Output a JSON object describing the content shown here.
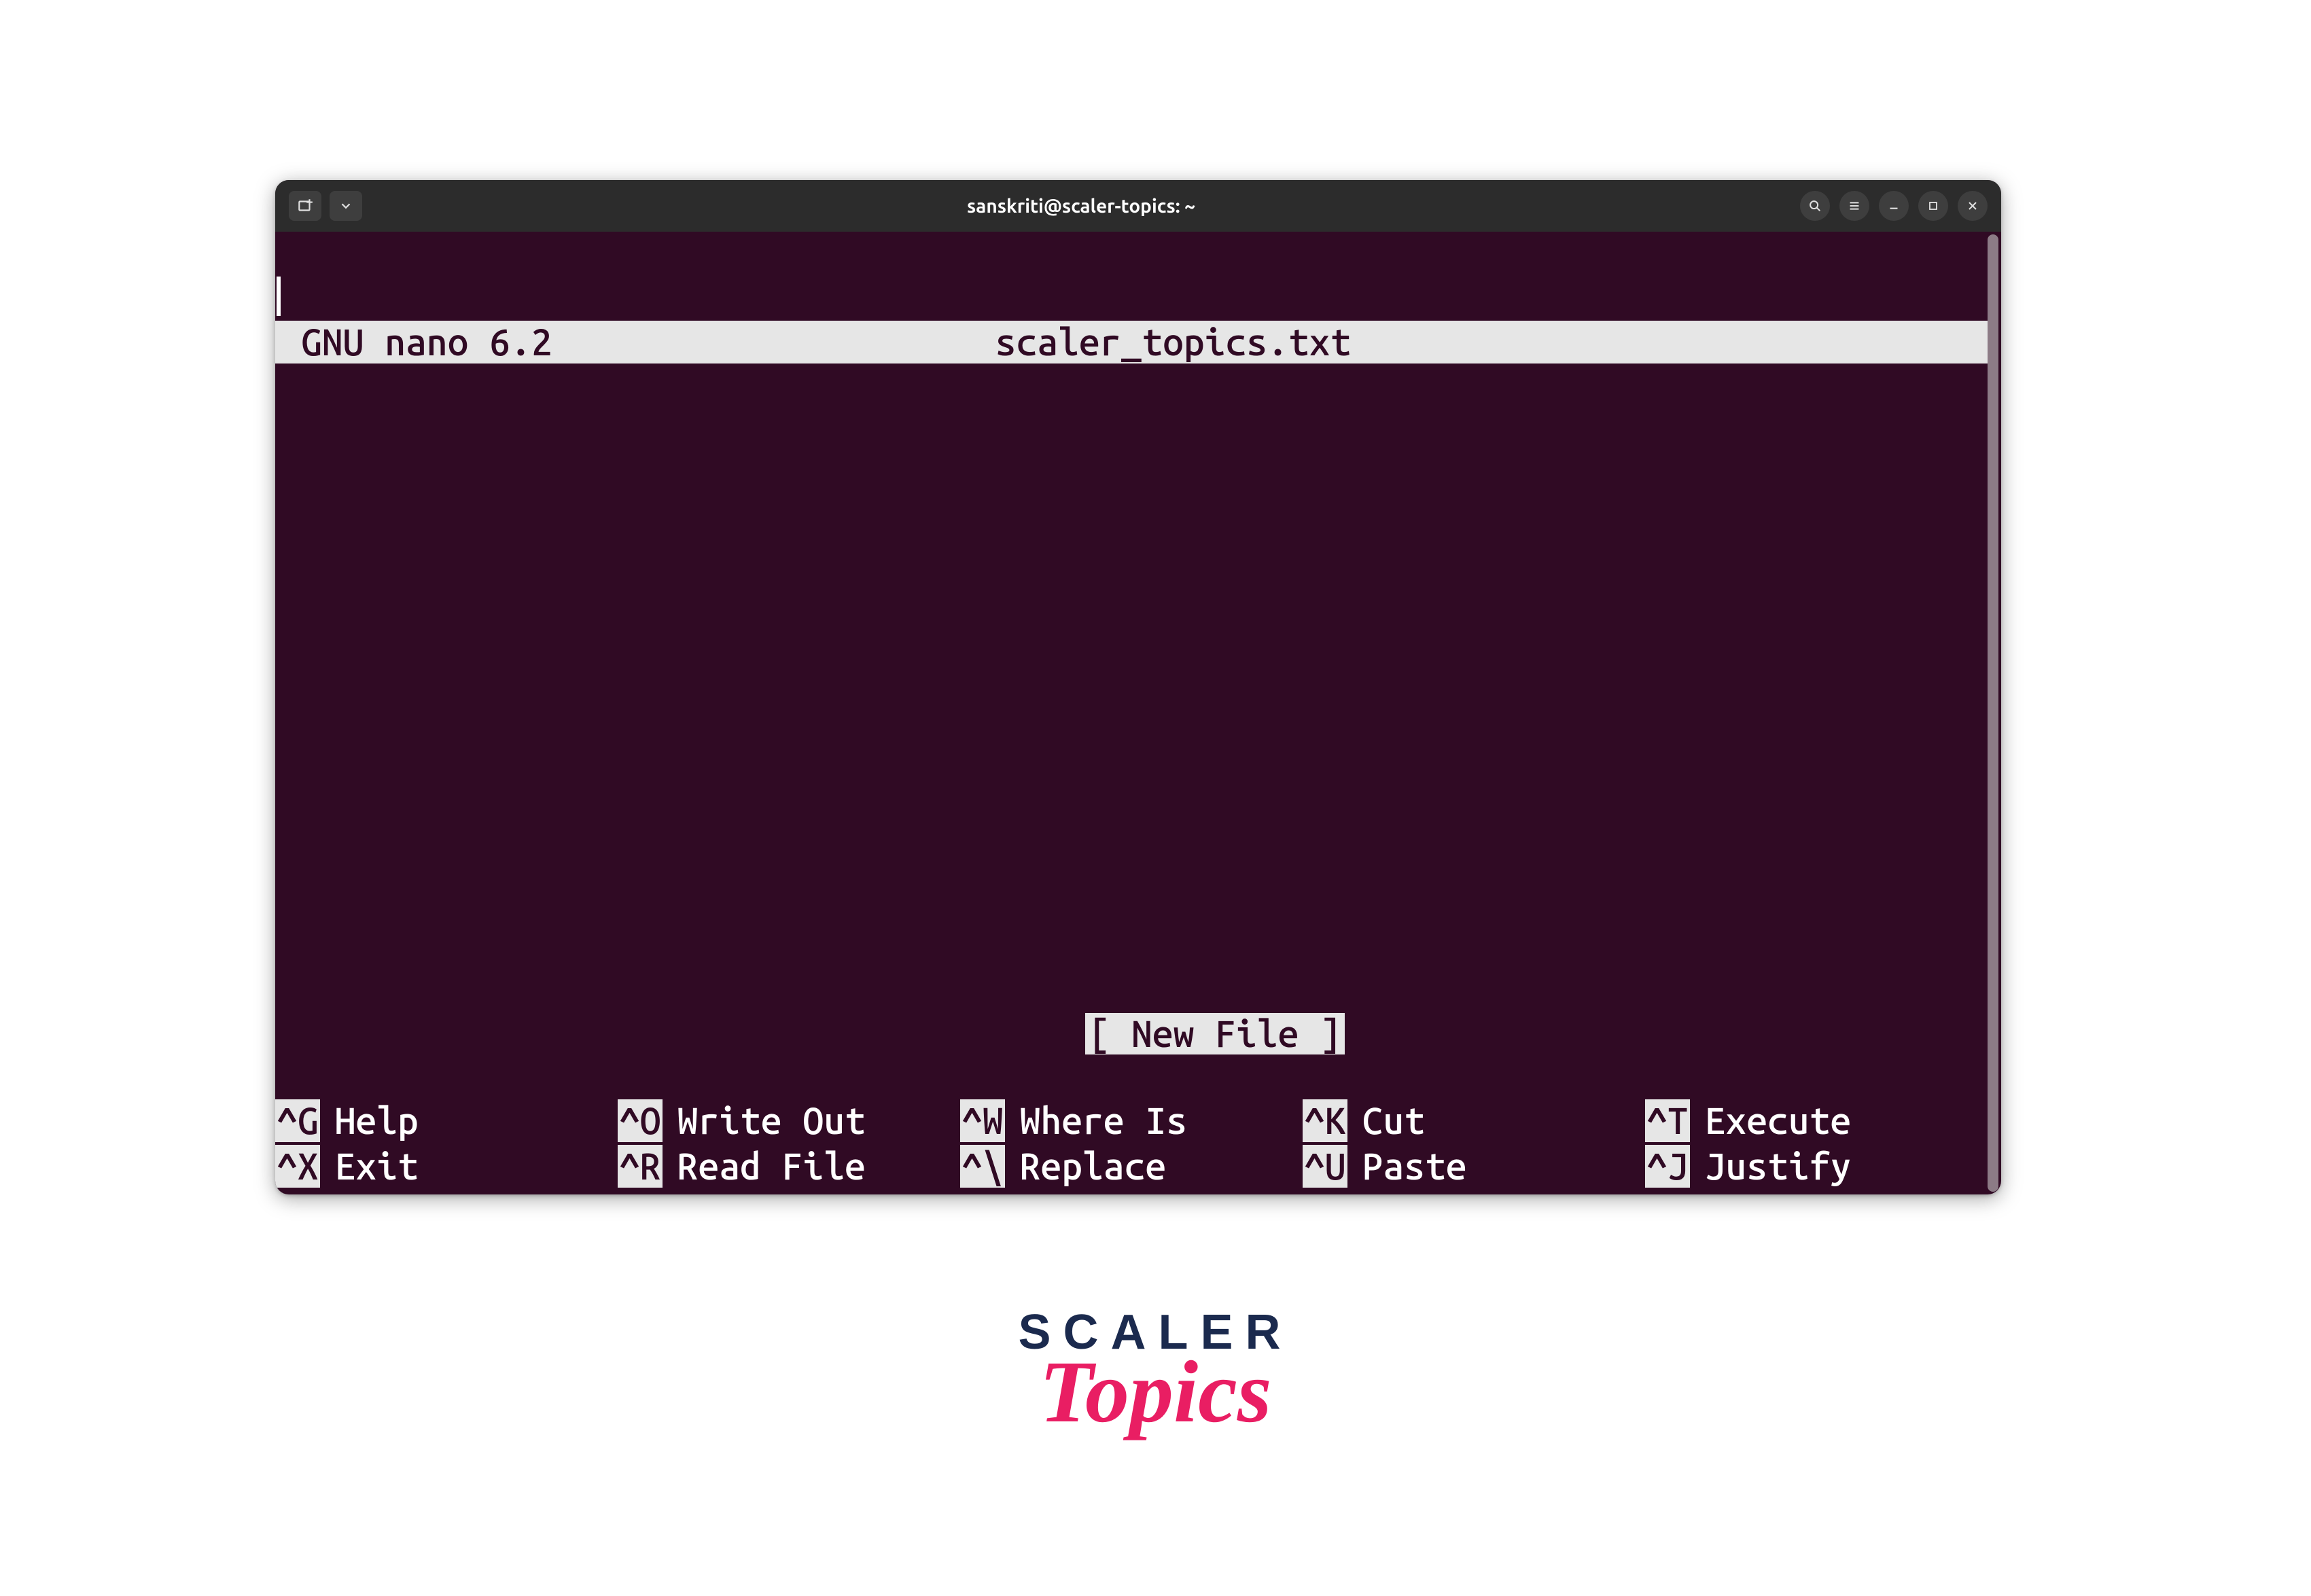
{
  "titlebar": {
    "title": "sanskriti@scaler-topics: ~"
  },
  "nano": {
    "app_name": "GNU nano 6.2",
    "filename": "scaler_topics.txt",
    "status": "[ New File ]"
  },
  "shortcuts": [
    {
      "key": "^G",
      "label": "Help"
    },
    {
      "key": "^X",
      "label": "Exit"
    },
    {
      "key": "^O",
      "label": "Write Out"
    },
    {
      "key": "^R",
      "label": "Read File"
    },
    {
      "key": "^W",
      "label": "Where Is"
    },
    {
      "key": "^\\",
      "label": "Replace"
    },
    {
      "key": "^K",
      "label": "Cut"
    },
    {
      "key": "^U",
      "label": "Paste"
    },
    {
      "key": "^T",
      "label": "Execute"
    },
    {
      "key": "^J",
      "label": "Justify"
    }
  ],
  "brand": {
    "line1": "SCALER",
    "line2": "Topics"
  }
}
